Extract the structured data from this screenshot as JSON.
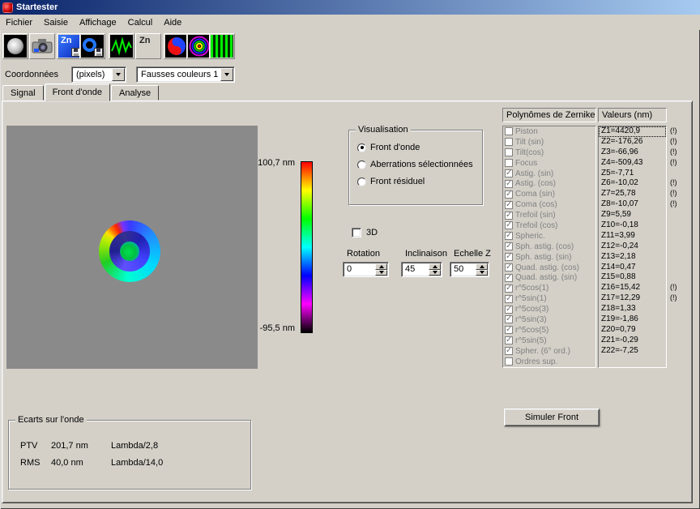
{
  "window": {
    "title": "Startester"
  },
  "colors": {
    "titlebar_left": "#0a246a",
    "titlebar_right": "#a6caf0",
    "chrome": "#d4d0c8",
    "image_background": "#8a8a8a"
  },
  "menu": {
    "items": [
      {
        "label": "Fichier"
      },
      {
        "label": "Saisie"
      },
      {
        "label": "Affichage"
      },
      {
        "label": "Calcul"
      },
      {
        "label": "Aide"
      }
    ]
  },
  "toolbar": {
    "zn_blue_label": "Zn",
    "zn_gray_label": "Zn"
  },
  "coordbar": {
    "label": "Coordonnées",
    "coord_select": "(pixels)",
    "palette_select": "Fausses couleurs 1"
  },
  "tabs": {
    "items": [
      {
        "label": "Signal"
      },
      {
        "label": "Front d'onde",
        "active": true
      },
      {
        "label": "Analyse"
      }
    ]
  },
  "colorbar": {
    "max_label": "100,7 nm",
    "min_label": "-95,5 nm",
    "gradient_stops": [
      "#ff0000",
      "#ffff00",
      "#00ff00",
      "#00ffff",
      "#0000ff",
      "#ff00ff",
      "#000000"
    ]
  },
  "visualisation": {
    "title": "Visualisation",
    "options": [
      {
        "label": "Front d'onde",
        "selected": true
      },
      {
        "label": "Aberrations sélectionnées"
      },
      {
        "label": "Front résiduel"
      }
    ]
  },
  "controls": {
    "checkbox_3d_label": "3D",
    "spinners": [
      {
        "label": "Rotation",
        "value": "0"
      },
      {
        "label": "Inclinaison",
        "value": "45"
      },
      {
        "label": "Echelle Z",
        "value": "50"
      }
    ]
  },
  "zernike": {
    "header_left": "Polynômes de Zernike",
    "header_right": "Valeurs (nm)",
    "rows": [
      {
        "name": "Piston",
        "value": "Z1=4420,9",
        "flag": "(!)",
        "selected": true
      },
      {
        "name": "Tilt (sin)",
        "value": "Z2=-176,26",
        "flag": "(!)"
      },
      {
        "name": "Tilt(cos)",
        "value": "Z3=-66,96",
        "flag": "(!)"
      },
      {
        "name": "Focus",
        "value": "Z4=-509,43",
        "flag": "(!)"
      },
      {
        "name": "Astig. (sin)",
        "value": "Z5=-7,71",
        "checked": true
      },
      {
        "name": "Astig. (cos)",
        "value": "Z6=-10,02",
        "flag": "(!)",
        "checked": true
      },
      {
        "name": "Coma (sin)",
        "value": "Z7=25,78",
        "flag": "(!)",
        "checked": true
      },
      {
        "name": "Coma (cos)",
        "value": "Z8=-10,07",
        "flag": "(!)",
        "checked": true
      },
      {
        "name": "Trefoil (sin)",
        "value": "Z9=5,59",
        "checked": true
      },
      {
        "name": "Trefoil (cos)",
        "value": "Z10=-0,18",
        "checked": true
      },
      {
        "name": "Spheric.",
        "value": "Z11=3,99",
        "checked": true
      },
      {
        "name": "Sph. astig. (cos)",
        "value": "Z12=-0,24",
        "checked": true
      },
      {
        "name": "Sph. astig. (sin)",
        "value": "Z13=2,18",
        "checked": true
      },
      {
        "name": "Quad. astig. (cos)",
        "value": "Z14=0,47",
        "checked": true
      },
      {
        "name": "Quad. astig. (sin)",
        "value": "Z15=0,88",
        "checked": true
      },
      {
        "name": "r^5cos(1)",
        "value": "Z16=15,42",
        "flag": "(!)",
        "checked": true
      },
      {
        "name": "r^5sin(1)",
        "value": "Z17=12,29",
        "flag": "(!)",
        "checked": true
      },
      {
        "name": "r^5cos(3)",
        "value": "Z18=1,33",
        "checked": true
      },
      {
        "name": "r^5sin(3)",
        "value": "Z19=-1,86",
        "checked": true
      },
      {
        "name": "r^5cos(5)",
        "value": "Z20=0,79",
        "checked": true
      },
      {
        "name": "r^5sin(5)",
        "value": "Z21=-0,29",
        "checked": true
      },
      {
        "name": "Spher. (6° ord.)",
        "value": "Z22=-7,25",
        "checked": true
      },
      {
        "name": "Ordres sup."
      }
    ]
  },
  "actions": {
    "simulate_label": "Simuler Front"
  },
  "ecarts": {
    "title": "Ecarts sur l'onde",
    "rows": [
      {
        "label": "PTV",
        "value": "201,7 nm",
        "lambda": "Lambda/2,8"
      },
      {
        "label": "RMS",
        "value": "40,0 nm",
        "lambda": "Lambda/14,0"
      }
    ]
  }
}
